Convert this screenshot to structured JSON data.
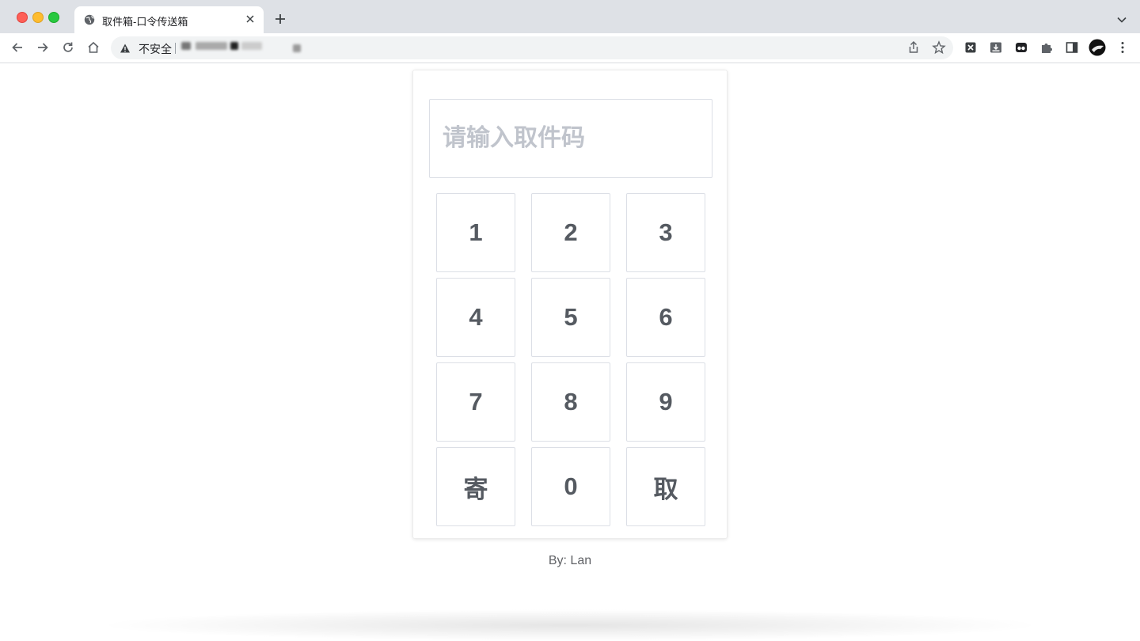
{
  "browser": {
    "tab_title": "取件箱-口令传送箱",
    "security_label": "不安全",
    "colors": {
      "titlebar": "#dee1e6",
      "close_button": "#fe5f57",
      "minimize_button": "#febc2e",
      "maximize_button": "#28c840"
    },
    "icons": {
      "favicon": "globe-icon",
      "tab_close": "close-icon",
      "new_tab": "plus-icon",
      "tab_search": "chevron-down-icon",
      "back": "back-arrow-icon",
      "forward": "forward-arrow-icon",
      "reload": "reload-icon",
      "home": "home-icon",
      "warning": "warning-icon",
      "share": "share-icon",
      "bookmark": "star-icon",
      "extension_1": "excel-extension-icon",
      "extension_2": "download-extension-icon",
      "extension_3": "extension-icon",
      "extensions": "puzzle-icon",
      "side_panel": "side-panel-icon",
      "profile": "avatar",
      "menu": "kebab-menu-icon"
    }
  },
  "page": {
    "input": {
      "placeholder": "请输入取件码",
      "value": ""
    },
    "keys": [
      "1",
      "2",
      "3",
      "4",
      "5",
      "6",
      "7",
      "8",
      "9",
      "寄",
      "0",
      "取"
    ],
    "footer": "By: Lan",
    "colors": {
      "key_text": "#555a61",
      "placeholder": "#c0c4cc",
      "border": "#dcdfe6"
    }
  }
}
